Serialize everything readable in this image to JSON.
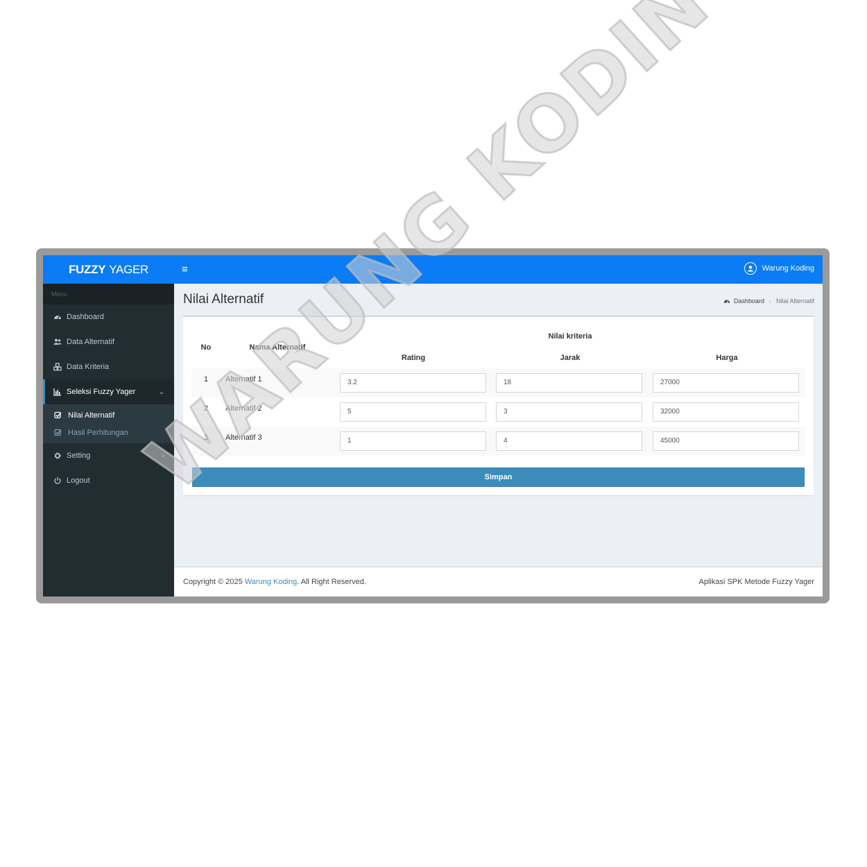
{
  "app": {
    "logo_bold": "FUZZY",
    "logo_rest": "YAGER",
    "user_name": "Warung Koding"
  },
  "sidebar": {
    "header": "Menu",
    "items": [
      {
        "label": "Dashboard",
        "icon": "dashboard-icon"
      },
      {
        "label": "Data Alternatif",
        "icon": "users-icon"
      },
      {
        "label": "Data Kriteria",
        "icon": "cubes-icon"
      },
      {
        "label": "Seleksi Fuzzy Yager",
        "icon": "bar-chart-icon"
      },
      {
        "label": "Setting",
        "icon": "gear-icon"
      },
      {
        "label": "Logout",
        "icon": "power-icon"
      }
    ],
    "submenu": [
      {
        "label": "Nilai Alternatif"
      },
      {
        "label": "Hasil Perhitungan"
      }
    ]
  },
  "page": {
    "title": "Nilai Alternatif",
    "breadcrumb": [
      "Dashboard",
      "Nilai Alternatif"
    ]
  },
  "table": {
    "headers": {
      "no": "No",
      "name": "Nama Alternatif",
      "group": "Nilai kriteria",
      "criteria": [
        "Rating",
        "Jarak",
        "Harga"
      ]
    },
    "rows": [
      {
        "no": "1",
        "name": "Alternatif 1",
        "values": [
          "3.2",
          "18",
          "27000"
        ]
      },
      {
        "no": "2",
        "name": "Alternatif 2",
        "values": [
          "5",
          "3",
          "32000"
        ]
      },
      {
        "no": "3",
        "name": "Alternatif 3",
        "values": [
          "1",
          "4",
          "45000"
        ]
      }
    ]
  },
  "actions": {
    "save_label": "Simpan"
  },
  "footer": {
    "copyright_prefix": "Copyright © 2025 ",
    "copyright_link": "Warung Koding",
    "copyright_suffix": ". All Right Reserved.",
    "right": "Aplikasi SPK Metode Fuzzy Yager"
  },
  "watermark": "WARUNG KODING",
  "colors": {
    "topbar": "#0b7cf5",
    "sidebar": "#222d32",
    "primary_button": "#3c8dbc"
  }
}
